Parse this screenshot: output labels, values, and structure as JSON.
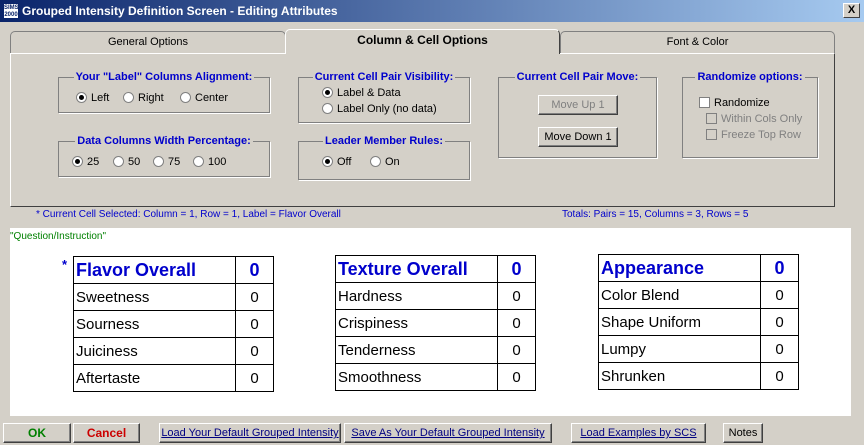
{
  "window": {
    "title": "Grouped Intensity Definition Screen - Editing Attributes",
    "icon_text": "SIMS 2000",
    "close_label": "X"
  },
  "tabs": [
    {
      "label": "General Options"
    },
    {
      "label": "Column & Cell Options"
    },
    {
      "label": "Font & Color"
    }
  ],
  "label_alignment": {
    "title": "Your \"Label\" Columns Alignment:",
    "options": [
      "Left",
      "Right",
      "Center"
    ],
    "selected": "Left"
  },
  "data_width": {
    "title": "Data Columns Width Percentage:",
    "options": [
      "25",
      "50",
      "75",
      "100"
    ],
    "selected": "25"
  },
  "visibility": {
    "title": "Current Cell Pair Visibility:",
    "options": [
      "Label & Data",
      "Label Only  (no data)"
    ],
    "selected": "Label & Data"
  },
  "leader": {
    "title": "Leader Member Rules:",
    "options": [
      "Off",
      "On"
    ],
    "selected": "Off"
  },
  "move": {
    "title": "Current Cell Pair Move:",
    "up_label": "Move Up 1",
    "down_label": "Move Down 1"
  },
  "randomize": {
    "title": "Randomize options:",
    "randomize_label": "Randomize",
    "within_label": "Within Cols Only",
    "freeze_label": "Freeze Top Row"
  },
  "status": {
    "current": "* Current Cell Selected:   Column = 1,  Row = 1,  Label = Flavor Overall",
    "totals": "Totals: Pairs = 15, Columns = 3, Rows = 5"
  },
  "question": "\"Question/Instruction\"",
  "selected_marker": "*",
  "columns": [
    {
      "header": "Flavor Overall",
      "header_value": "0",
      "rows": [
        {
          "label": "Sweetness",
          "value": "0"
        },
        {
          "label": "Sourness",
          "value": "0"
        },
        {
          "label": "Juiciness",
          "value": "0"
        },
        {
          "label": "Aftertaste",
          "value": "0"
        }
      ]
    },
    {
      "header": "Texture Overall",
      "header_value": "0",
      "rows": [
        {
          "label": "Hardness",
          "value": "0"
        },
        {
          "label": "Crispiness",
          "value": "0"
        },
        {
          "label": "Tenderness",
          "value": "0"
        },
        {
          "label": "Smoothness",
          "value": "0"
        }
      ]
    },
    {
      "header": "Appearance",
      "header_value": "0",
      "rows": [
        {
          "label": "Color Blend",
          "value": "0"
        },
        {
          "label": "Shape Uniform",
          "value": "0"
        },
        {
          "label": "Lumpy",
          "value": "0"
        },
        {
          "label": "Shrunken",
          "value": "0"
        }
      ]
    }
  ],
  "buttons": {
    "ok": "OK",
    "cancel": "Cancel",
    "load_default": "Load Your Default Grouped Intensity",
    "save_default": "Save As Your Default Grouped Intensity",
    "load_examples": "Load Examples by SCS",
    "notes": "Notes"
  }
}
